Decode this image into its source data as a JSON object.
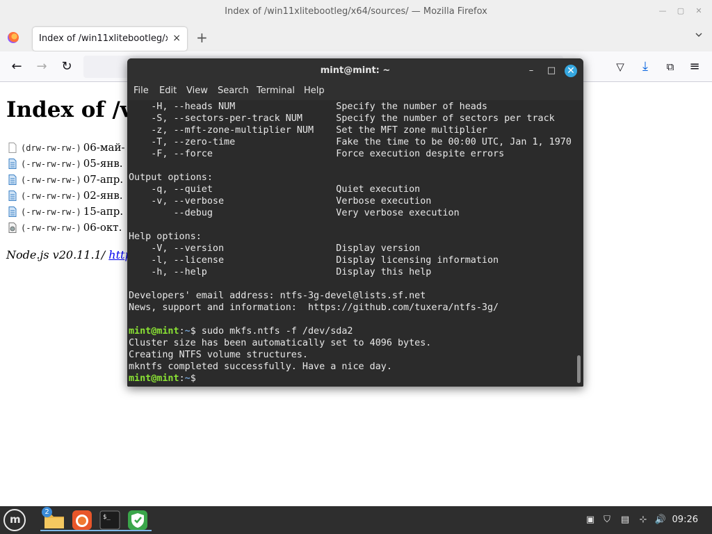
{
  "firefox": {
    "window_title": "Index of /win11xlitebootleg/x64/sources/ — Mozilla Firefox",
    "tab_label": "Index of /win11xlitebootleg/x64/sources/",
    "tab_close": "×",
    "new_tab": "+",
    "icons": {
      "minimize": "minimize-icon",
      "maximize": "maximize-icon",
      "close": "close-icon",
      "back": "back-arrow-icon",
      "forward": "forward-arrow-icon",
      "reload": "reload-icon",
      "pocket": "pocket-icon",
      "downloads": "download-icon",
      "extensions": "puzzle-icon",
      "menu": "hamburger-menu-icon"
    }
  },
  "page": {
    "heading": "Index of /v",
    "entries": [
      {
        "perm": "(drw-rw-rw-)",
        "date": "06-май-",
        "icon": "folder"
      },
      {
        "perm": "(-rw-rw-rw-)",
        "date": "05-янв.",
        "icon": "file"
      },
      {
        "perm": "(-rw-rw-rw-)",
        "date": "07-апр.",
        "icon": "file"
      },
      {
        "perm": "(-rw-rw-rw-)",
        "date": "02-янв.",
        "icon": "file"
      },
      {
        "perm": "(-rw-rw-rw-)",
        "date": "15-апр.",
        "icon": "file"
      },
      {
        "perm": "(-rw-rw-rw-)",
        "date": "06-окт.",
        "icon": "image"
      }
    ],
    "footer_text": "Node.js v20.11.1/",
    "footer_link": "http"
  },
  "terminal": {
    "title": "mint@mint: ~",
    "menu": [
      "File",
      "Edit",
      "View",
      "Search",
      "Terminal",
      "Help"
    ],
    "output_before": "    -H, --heads NUM                  Specify the number of heads\n    -S, --sectors-per-track NUM      Specify the number of sectors per track\n    -z, --mft-zone-multiplier NUM    Set the MFT zone multiplier\n    -T, --zero-time                  Fake the time to be 00:00 UTC, Jan 1, 1970\n    -F, --force                      Force execution despite errors\n\nOutput options:\n    -q, --quiet                      Quiet execution\n    -v, --verbose                    Verbose execution\n        --debug                      Very verbose execution\n\nHelp options:\n    -V, --version                    Display version\n    -l, --license                    Display licensing information\n    -h, --help                       Display this help\n\nDevelopers' email address: ntfs-3g-devel@lists.sf.net\nNews, support and information:  https://github.com/tuxera/ntfs-3g/\n\n",
    "prompt_user": "mint@mint",
    "prompt_sep": ":",
    "prompt_path": "~",
    "prompt_symbol": "$",
    "command": " sudo mkfs.ntfs -f /dev/sda2",
    "output_after": "Cluster size has been automatically set to 4096 bytes.\nCreating NTFS volume structures.\nmkntfs completed successfully. Have a nice day.\n"
  },
  "taskbar": {
    "menu_icon": "mint-menu-icon",
    "files_badge": "2",
    "apps": [
      "files-icon",
      "firefox-icon",
      "terminal-icon",
      "shield-icon"
    ],
    "tray": [
      "clipboard-icon",
      "update-shield-icon",
      "battery-icon",
      "network-icon",
      "volume-icon"
    ],
    "clock": "09:26"
  }
}
